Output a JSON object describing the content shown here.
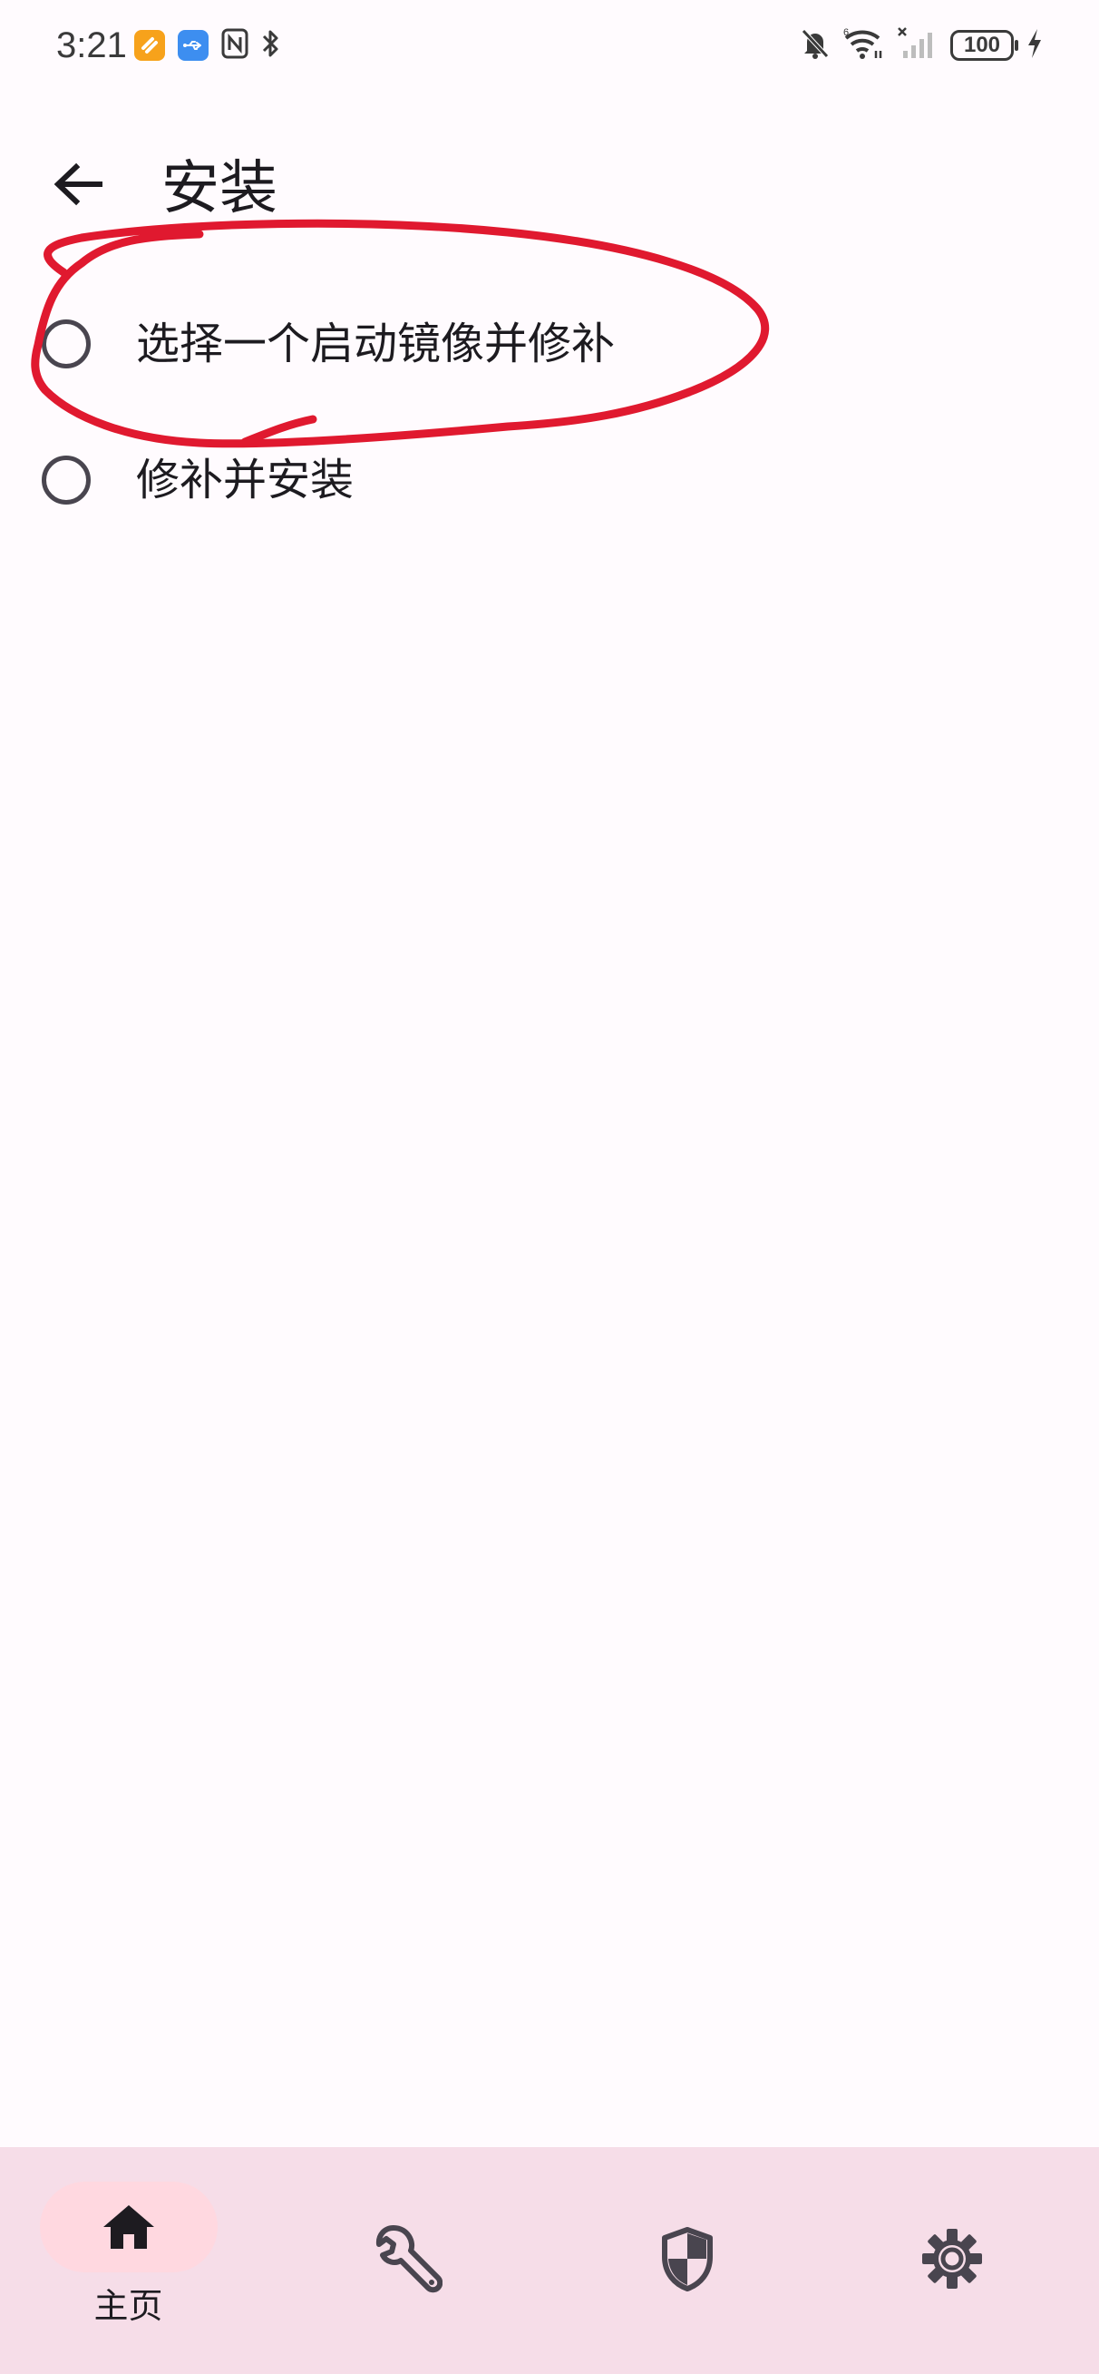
{
  "status_bar": {
    "time": "3:21",
    "battery": "100",
    "left_icons": [
      "orange-app-icon",
      "usb-icon",
      "nfc-icon",
      "bluetooth-icon"
    ],
    "right_icons": [
      "bell-off-icon",
      "wifi-icon",
      "no-signal-icon",
      "battery-icon",
      "charging-icon"
    ]
  },
  "top_bar": {
    "title": "安装",
    "back_icon": "arrow-left-icon"
  },
  "options": [
    {
      "label": "选择一个启动镜像并修补",
      "selected": false
    },
    {
      "label": "修补并安装",
      "selected": false
    }
  ],
  "annotation": {
    "color": "#e0192f"
  },
  "bottom_nav": {
    "items": [
      {
        "icon": "home-icon",
        "label": "主页",
        "active": true
      },
      {
        "icon": "wrench-icon",
        "label": "",
        "active": false
      },
      {
        "icon": "shield-icon",
        "label": "",
        "active": false
      },
      {
        "icon": "gear-icon",
        "label": "",
        "active": false
      }
    ]
  },
  "colors": {
    "background": "#fffbfe",
    "nav_background": "#f6dde8",
    "nav_indicator": "#ffd8e0",
    "text": "#1d1b20",
    "icon": "#49454f"
  }
}
